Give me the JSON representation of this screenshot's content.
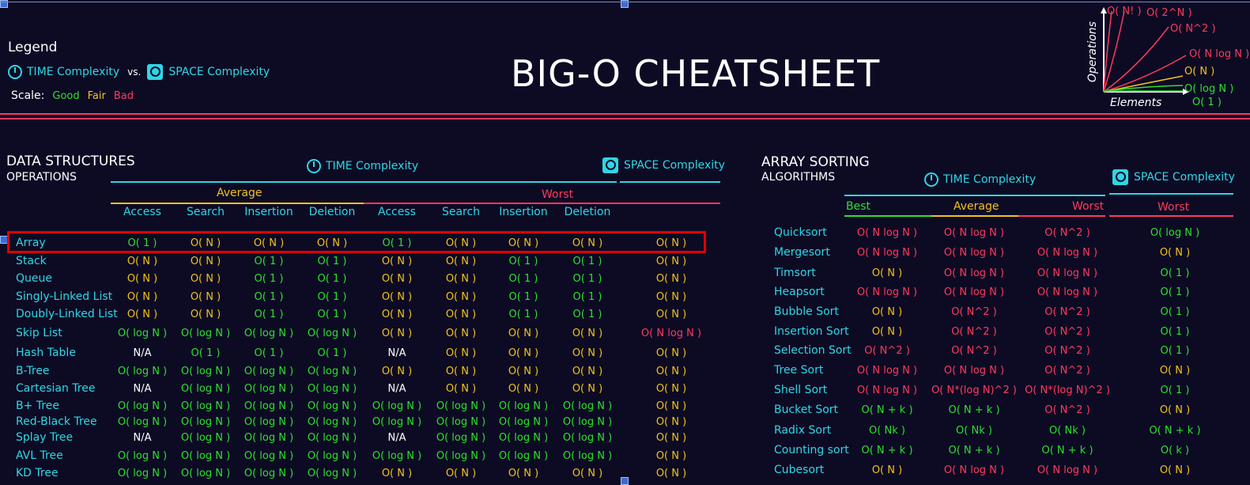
{
  "legend": {
    "title": "Legend",
    "time_label": "TIME Complexity",
    "vs": "vs.",
    "space_label": "SPACE Complexity",
    "scale_label": "Scale:",
    "good": "Good",
    "fair": "Fair",
    "bad": "Bad"
  },
  "title": "BIG-O CHEATSHEET",
  "graph": {
    "y_label": "Operations",
    "x_label": "Elements",
    "curves": [
      "O( N! )",
      "O( 2^N )",
      "O( N^2 )",
      "O( N log N )",
      "O( N )",
      "O( log N )",
      "O( 1 )"
    ]
  },
  "ds": {
    "title_line1": "DATA STRUCTURES",
    "title_line2": "OPERATIONS",
    "time_label": "TIME Complexity",
    "space_label": "SPACE Complexity",
    "average": "Average",
    "worst": "Worst",
    "columns": [
      "Access",
      "Search",
      "Insertion",
      "Deletion",
      "Access",
      "Search",
      "Insertion",
      "Deletion"
    ],
    "rows": [
      {
        "name": "Array",
        "cells": [
          "O( 1 )",
          "O( N )",
          "O( N )",
          "O( N )",
          "O( 1 )",
          "O( N )",
          "O( N )",
          "O( N )",
          "O( N )"
        ],
        "cls": [
          "good",
          "fair",
          "fair",
          "fair",
          "good",
          "fair",
          "fair",
          "fair",
          "fair"
        ]
      },
      {
        "name": "Stack",
        "cells": [
          "O( N )",
          "O( N )",
          "O( 1 )",
          "O( 1 )",
          "O( N )",
          "O( N )",
          "O( 1 )",
          "O( 1 )",
          "O( N )"
        ],
        "cls": [
          "fair",
          "fair",
          "good",
          "good",
          "fair",
          "fair",
          "good",
          "good",
          "fair"
        ]
      },
      {
        "name": "Queue",
        "cells": [
          "O( N )",
          "O( N )",
          "O( 1 )",
          "O( 1 )",
          "O( N )",
          "O( N )",
          "O( 1 )",
          "O( 1 )",
          "O( N )"
        ],
        "cls": [
          "fair",
          "fair",
          "good",
          "good",
          "fair",
          "fair",
          "good",
          "good",
          "fair"
        ]
      },
      {
        "name": "Singly-Linked List",
        "cells": [
          "O( N )",
          "O( N )",
          "O( 1 )",
          "O( 1 )",
          "O( N )",
          "O( N )",
          "O( 1 )",
          "O( 1 )",
          "O( N )"
        ],
        "cls": [
          "fair",
          "fair",
          "good",
          "good",
          "fair",
          "fair",
          "good",
          "good",
          "fair"
        ]
      },
      {
        "name": "Doubly-Linked List",
        "cells": [
          "O( N )",
          "O( N )",
          "O( 1 )",
          "O( 1 )",
          "O( N )",
          "O( N )",
          "O( 1 )",
          "O( 1 )",
          "O( N )"
        ],
        "cls": [
          "fair",
          "fair",
          "good",
          "good",
          "fair",
          "fair",
          "good",
          "good",
          "fair"
        ]
      },
      {
        "name": "Skip List",
        "cells": [
          "O( log N )",
          "O( log N )",
          "O( log N )",
          "O( log N )",
          "O( N )",
          "O( N )",
          "O( N )",
          "O( N )",
          "O( N log N )"
        ],
        "cls": [
          "good",
          "good",
          "good",
          "good",
          "fair",
          "fair",
          "fair",
          "fair",
          "bad"
        ]
      },
      {
        "name": "Hash Table",
        "cells": [
          "N/A",
          "O( 1 )",
          "O( 1 )",
          "O( 1 )",
          "N/A",
          "O( N )",
          "O( N )",
          "O( N )",
          "O( N )"
        ],
        "cls": [
          "na",
          "good",
          "good",
          "good",
          "na",
          "fair",
          "fair",
          "fair",
          "fair"
        ]
      },
      {
        "name": "B-Tree",
        "cells": [
          "O( log N )",
          "O( log N )",
          "O( log N )",
          "O( log N )",
          "O( N )",
          "O( N )",
          "O( N )",
          "O( N )",
          "O( N )"
        ],
        "cls": [
          "good",
          "good",
          "good",
          "good",
          "fair",
          "fair",
          "fair",
          "fair",
          "fair"
        ]
      },
      {
        "name": "Cartesian Tree",
        "cells": [
          "N/A",
          "O( log N )",
          "O( log N )",
          "O( log N )",
          "N/A",
          "O( N )",
          "O( N )",
          "O( N )",
          "O( N )"
        ],
        "cls": [
          "na",
          "good",
          "good",
          "good",
          "na",
          "fair",
          "fair",
          "fair",
          "fair"
        ]
      },
      {
        "name": "B+ Tree",
        "cells": [
          "O( log N )",
          "O( log N )",
          "O( log N )",
          "O( log N )",
          "O( log N )",
          "O( log N )",
          "O( log N )",
          "O( log N )",
          "O( N )"
        ],
        "cls": [
          "good",
          "good",
          "good",
          "good",
          "good",
          "good",
          "good",
          "good",
          "fair"
        ]
      },
      {
        "name": "Red-Black Tree",
        "cells": [
          "O( log N )",
          "O( log N )",
          "O( log N )",
          "O( log N )",
          "O( log N )",
          "O( log N )",
          "O( log N )",
          "O( log N )",
          "O( N )"
        ],
        "cls": [
          "good",
          "good",
          "good",
          "good",
          "good",
          "good",
          "good",
          "good",
          "fair"
        ]
      },
      {
        "name": "Splay Tree",
        "cells": [
          "N/A",
          "O( log N )",
          "O( log N )",
          "O( log N )",
          "N/A",
          "O( log N )",
          "O( log N )",
          "O( log N )",
          "O( N )"
        ],
        "cls": [
          "na",
          "good",
          "good",
          "good",
          "na",
          "good",
          "good",
          "good",
          "fair"
        ]
      },
      {
        "name": "AVL Tree",
        "cells": [
          "O( log N )",
          "O( log N )",
          "O( log N )",
          "O( log N )",
          "O( log N )",
          "O( log N )",
          "O( log N )",
          "O( log N )",
          "O( N )"
        ],
        "cls": [
          "good",
          "good",
          "good",
          "good",
          "good",
          "good",
          "good",
          "good",
          "fair"
        ]
      },
      {
        "name": "KD Tree",
        "cells": [
          "O( log N )",
          "O( log N )",
          "O( log N )",
          "O( log N )",
          "O( N )",
          "O( N )",
          "O( N )",
          "O( N )",
          "O( N )"
        ],
        "cls": [
          "good",
          "good",
          "good",
          "good",
          "fair",
          "fair",
          "fair",
          "fair",
          "fair"
        ]
      }
    ]
  },
  "sort": {
    "title_line1": "ARRAY SORTING",
    "title_line2": "ALGORITHMS",
    "time_label": "TIME Complexity",
    "space_label": "SPACE Complexity",
    "best": "Best",
    "average": "Average",
    "worst": "Worst",
    "space_worst": "Worst",
    "rows": [
      {
        "name": "Quicksort",
        "cells": [
          "O( N log N )",
          "O( N log N )",
          "O( N^2 )",
          "O( log N )"
        ],
        "cls": [
          "bad",
          "bad",
          "bad",
          "good"
        ]
      },
      {
        "name": "Mergesort",
        "cells": [
          "O( N log N )",
          "O( N log N )",
          "O( N log N )",
          "O( N )"
        ],
        "cls": [
          "bad",
          "bad",
          "bad",
          "fair"
        ]
      },
      {
        "name": "Timsort",
        "cells": [
          "O( N )",
          "O( N log N )",
          "O( N log N )",
          "O( 1 )"
        ],
        "cls": [
          "fair",
          "bad",
          "bad",
          "good"
        ]
      },
      {
        "name": "Heapsort",
        "cells": [
          "O( N log N )",
          "O( N log N )",
          "O( N log N )",
          "O( 1 )"
        ],
        "cls": [
          "bad",
          "bad",
          "bad",
          "good"
        ]
      },
      {
        "name": "Bubble Sort",
        "cells": [
          "O( N )",
          "O( N^2 )",
          "O( N^2 )",
          "O( 1 )"
        ],
        "cls": [
          "fair",
          "bad",
          "bad",
          "good"
        ]
      },
      {
        "name": "Insertion Sort",
        "cells": [
          "O( N )",
          "O( N^2 )",
          "O( N^2 )",
          "O( 1 )"
        ],
        "cls": [
          "fair",
          "bad",
          "bad",
          "good"
        ]
      },
      {
        "name": "Selection Sort",
        "cells": [
          "O( N^2 )",
          "O( N^2 )",
          "O( N^2 )",
          "O( 1 )"
        ],
        "cls": [
          "bad",
          "bad",
          "bad",
          "good"
        ]
      },
      {
        "name": "Tree Sort",
        "cells": [
          "O( N log N )",
          "O( N log N )",
          "O( N^2 )",
          "O( N )"
        ],
        "cls": [
          "bad",
          "bad",
          "bad",
          "fair"
        ]
      },
      {
        "name": "Shell Sort",
        "cells": [
          "O( N log N )",
          "O( N*(log N)^2 )",
          "O( N*(log N)^2 )",
          "O( 1 )"
        ],
        "cls": [
          "bad",
          "bad",
          "bad",
          "good"
        ]
      },
      {
        "name": "Bucket Sort",
        "cells": [
          "O( N + k )",
          "O( N + k )",
          "O( N^2 )",
          "O( N )"
        ],
        "cls": [
          "good",
          "good",
          "bad",
          "fair"
        ]
      },
      {
        "name": "Radix Sort",
        "cells": [
          "O( Nk )",
          "O( Nk )",
          "O( Nk )",
          "O( N + k )"
        ],
        "cls": [
          "good",
          "good",
          "good",
          "good"
        ]
      },
      {
        "name": "Counting sort",
        "cells": [
          "O( N + k )",
          "O( N + k )",
          "O( N + k )",
          "O( k )"
        ],
        "cls": [
          "good",
          "good",
          "good",
          "good"
        ]
      },
      {
        "name": "Cubesort",
        "cells": [
          "O( N )",
          "O( N log N )",
          "O( N log N )",
          "O( N )"
        ],
        "cls": [
          "fair",
          "bad",
          "bad",
          "fair"
        ]
      }
    ]
  },
  "colors": {
    "good": "#2de02d",
    "fair": "#f2c21d",
    "bad": "#ff3a5c",
    "accent": "#2fd6e6",
    "highlight": "#e00000"
  }
}
